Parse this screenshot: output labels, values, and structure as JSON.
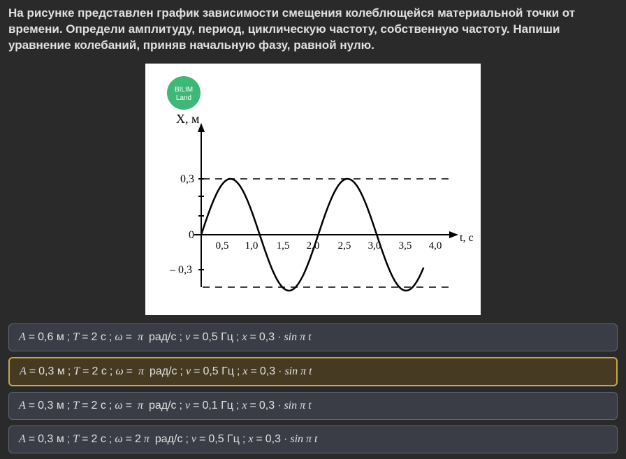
{
  "question": "На рисунке представлен график зависимости смещения колеблющейся материальной точки от времени. Определи амплитуду, период, циклическую частоту, собственную частоту. Напиши уравнение колебаний, приняв начальную фазу, равной нулю.",
  "logo": {
    "line1": "BILIM",
    "line2": "Land"
  },
  "chart_data": {
    "type": "line",
    "xlabel": "t, с",
    "ylabel": "X, м",
    "y_ticks": [
      "0,3",
      "0",
      "– 0,3"
    ],
    "x_ticks": [
      "0,5",
      "1,0",
      "1,5",
      "2,0",
      "2,5",
      "3,0",
      "3,5",
      "4,0"
    ],
    "amplitude": 0.3,
    "period": 2.0,
    "x_range": [
      0,
      4.0
    ],
    "y_range": [
      -0.4,
      0.4
    ],
    "function": "0.3*sin(pi*t)",
    "dashed_lines": [
      0.3,
      -0.3
    ]
  },
  "options": [
    {
      "A": "0,6 м",
      "T": "2 с",
      "omega_coeff": "",
      "omega": "π",
      "omega_unit": "рад/с",
      "nu": "0,5 Гц",
      "x_amp": "0,3",
      "eq_omega": "π",
      "selected": false
    },
    {
      "A": "0,3 м",
      "T": "2 с",
      "omega_coeff": "",
      "omega": "π",
      "omega_unit": "рад/с",
      "nu": "0,5 Гц",
      "x_amp": "0,3",
      "eq_omega": "π",
      "selected": true
    },
    {
      "A": "0,3 м",
      "T": "2 с",
      "omega_coeff": "",
      "omega": "π",
      "omega_unit": "рад/с",
      "nu": "0,1 Гц",
      "x_amp": "0,3",
      "eq_omega": "π",
      "selected": false
    },
    {
      "A": "0,3 м",
      "T": "2 с",
      "omega_coeff": "2",
      "omega": "π",
      "omega_unit": "рад/с",
      "nu": "0,5 Гц",
      "x_amp": "0,3",
      "eq_omega": "π",
      "selected": false
    }
  ]
}
